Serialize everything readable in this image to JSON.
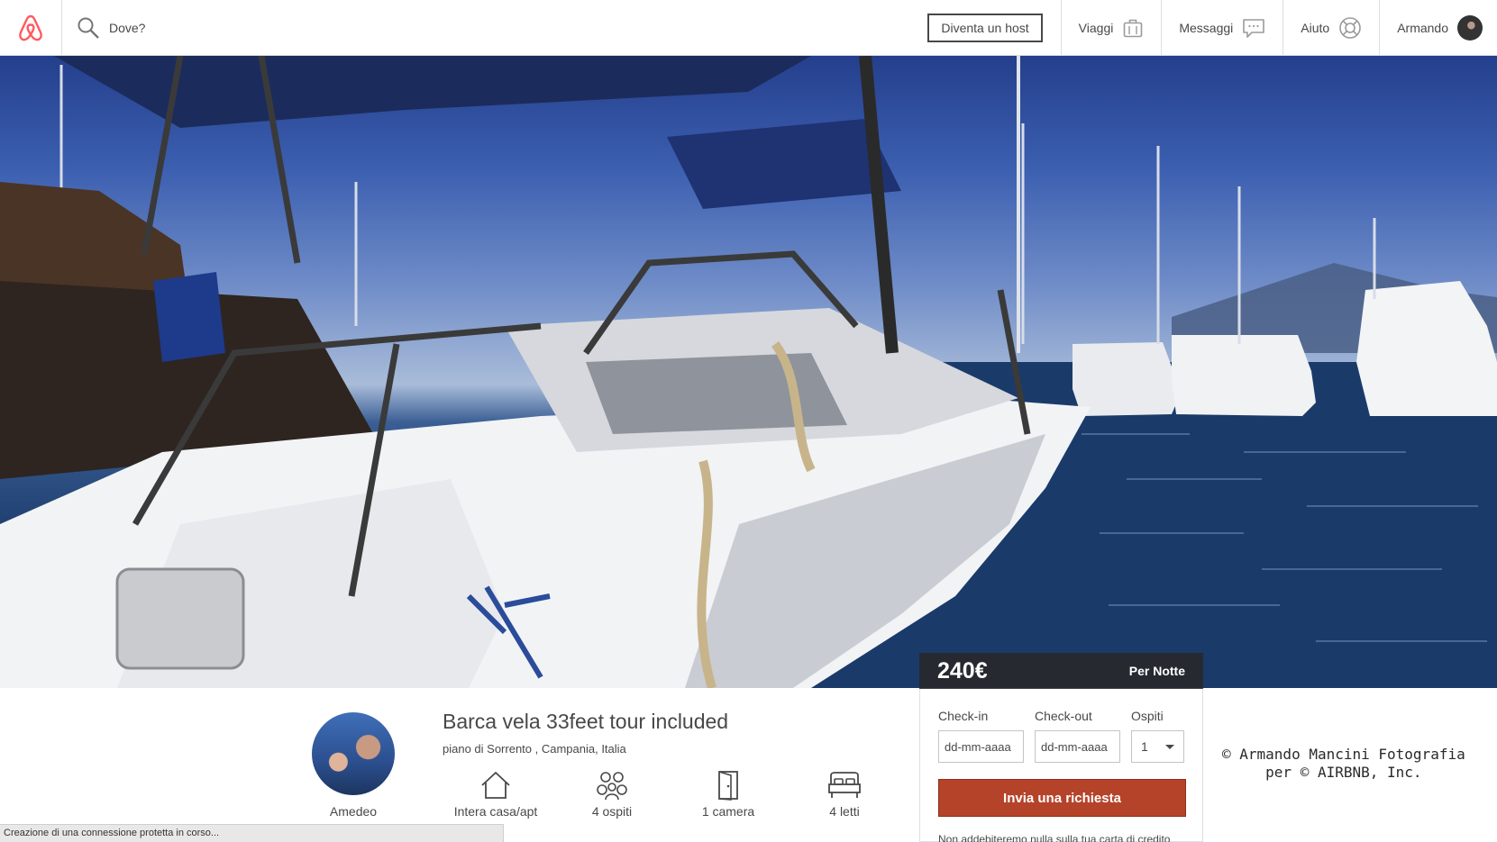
{
  "header": {
    "search_placeholder": "Dove?",
    "host_button": "Diventa un host",
    "nav": [
      {
        "label": "Viaggi",
        "icon": "suitcase-icon"
      },
      {
        "label": "Messaggi",
        "icon": "chat-icon"
      },
      {
        "label": "Aiuto",
        "icon": "lifebuoy-icon"
      },
      {
        "label": "Armando",
        "icon": "avatar"
      }
    ],
    "brand_color": "#FF5A5F"
  },
  "hero": {
    "watermark_line1": "© Armando Mancini Fotografia",
    "watermark_line2": "per © AIRBNB, Inc."
  },
  "booking": {
    "price": "240€",
    "per_night": "Per Notte",
    "checkin_label": "Check-in",
    "checkout_label": "Check-out",
    "guests_label": "Ospiti",
    "checkin_placeholder": "dd-mm-aaaa",
    "checkout_placeholder": "dd-mm-aaaa",
    "guests_value": "1",
    "request_button": "Invia una richiesta",
    "note": "Non addebiteremo nulla sulla tua carta di credito",
    "button_color": "#B5432A"
  },
  "listing": {
    "host_name": "Amedeo",
    "title": "Barca vela 33feet tour included",
    "location": "piano di Sorrento , Campania, Italia",
    "features": [
      {
        "label": "Intera casa/apt",
        "icon": "house-icon"
      },
      {
        "label": "4 ospiti",
        "icon": "guests-icon"
      },
      {
        "label": "1 camera",
        "icon": "door-icon"
      },
      {
        "label": "4 letti",
        "icon": "bed-icon"
      }
    ]
  },
  "status_bar": "Creazione di una connessione protetta in corso..."
}
